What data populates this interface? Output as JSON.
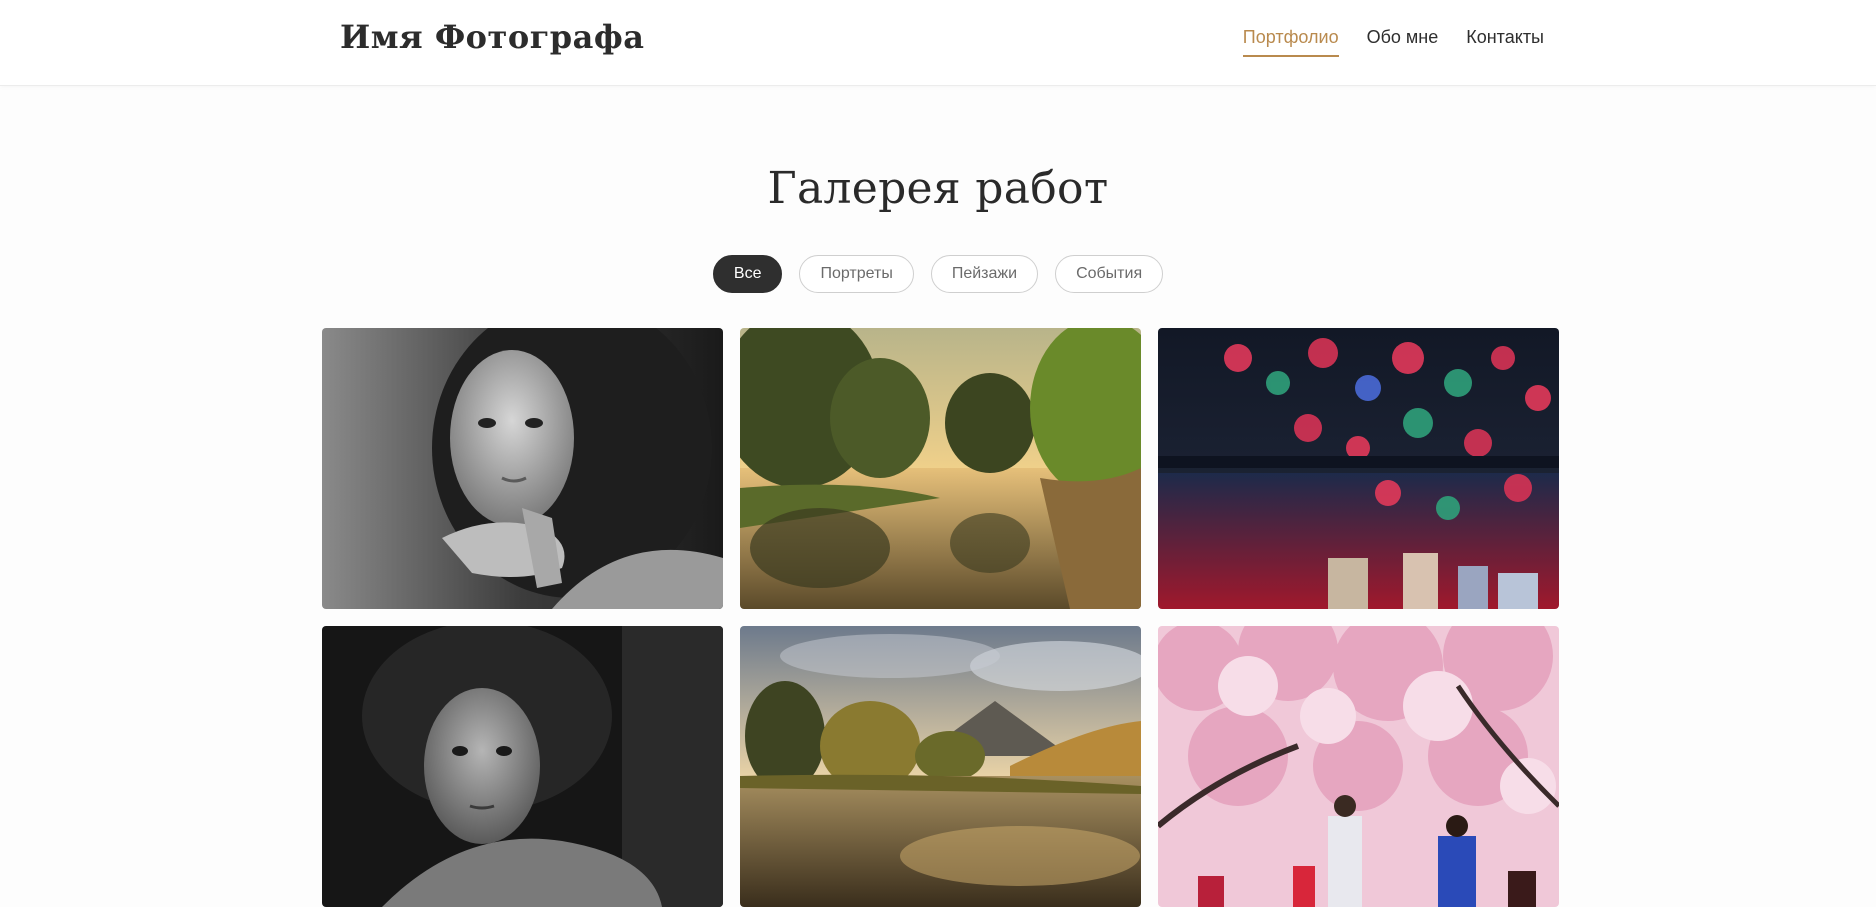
{
  "site": {
    "logo": "Имя Фотографа"
  },
  "nav": {
    "items": [
      {
        "label": "Портфолио",
        "active": true
      },
      {
        "label": "Обо мне",
        "active": false
      },
      {
        "label": "Контакты",
        "active": false
      }
    ]
  },
  "gallery": {
    "title": "Галерея работ",
    "filters": [
      {
        "label": "Все",
        "active": true
      },
      {
        "label": "Портреты",
        "active": false
      },
      {
        "label": "Пейзажи",
        "active": false
      },
      {
        "label": "События",
        "active": false
      }
    ],
    "photos": [
      {
        "category": "portrait",
        "subject": "black-and-white portrait of woman with hand on chin"
      },
      {
        "category": "landscape",
        "subject": "river at sunset with trees and reflection"
      },
      {
        "category": "event",
        "subject": "fireworks over city bay at night"
      },
      {
        "category": "portrait",
        "subject": "black-and-white portrait of curly-haired young man"
      },
      {
        "category": "landscape",
        "subject": "mountain lake with golden trees"
      },
      {
        "category": "event",
        "subject": "people photographing pink cherry blossoms"
      }
    ]
  },
  "colors": {
    "accent": "#b98a4e",
    "active_filter_bg": "#2f2f2f",
    "text": "#2b2b2b",
    "muted": "#6b6b6b"
  }
}
